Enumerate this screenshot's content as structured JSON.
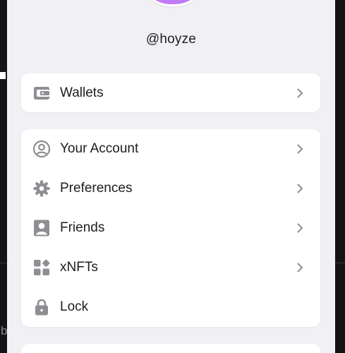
{
  "profile": {
    "username": "@hoyze",
    "avatar_colors": [
      "#f25c54",
      "#c07cf6",
      "#36c2f5",
      "#f7b538",
      "#f25c54",
      "#f2a65a",
      "#c07cf6",
      "#7b6cf6",
      "#f25c54",
      "#c07cf6",
      "#f25c54",
      "#f7b538",
      "#36c2f5",
      "#f25c54",
      "#c07cf6",
      "#f2a65a",
      "#f25c54",
      "#c07cf6",
      "#7b6cf6",
      "#f25c54",
      "#c07cf6",
      "#f25c54",
      "#f2a65a",
      "#f25c54",
      "#c07cf6",
      "#36c2f5",
      "#f25c54",
      "#f25c54",
      "#f7e05c",
      "#f25c54",
      "#c07cf6",
      "#f25c54",
      "#c07cf6",
      "#f25c54",
      "#c07cf6",
      "#f25c54",
      "#c07cf6",
      "#c07cf6",
      "#c07cf6",
      "#c07cf6",
      "#c07cf6",
      "#c07cf6",
      "#c07cf6",
      "#c07cf6",
      "#c07cf6"
    ]
  },
  "menu": {
    "wallets": {
      "label": "Wallets",
      "icon": "wallet-icon"
    },
    "items": [
      {
        "label": "Your Account",
        "icon": "user-circle-icon"
      },
      {
        "label": "Preferences",
        "icon": "gear-icon"
      },
      {
        "label": "Friends",
        "icon": "friends-icon"
      },
      {
        "label": "xNFTs",
        "icon": "apps-icon"
      },
      {
        "label": "Lock",
        "icon": "lock-icon"
      }
    ]
  },
  "background": {
    "partial_letter": "b"
  },
  "colors": {
    "icon": "#8e8e93",
    "chevron": "#8e8e93",
    "text": "#1d1d1f",
    "panel": "#f1f0f4"
  }
}
